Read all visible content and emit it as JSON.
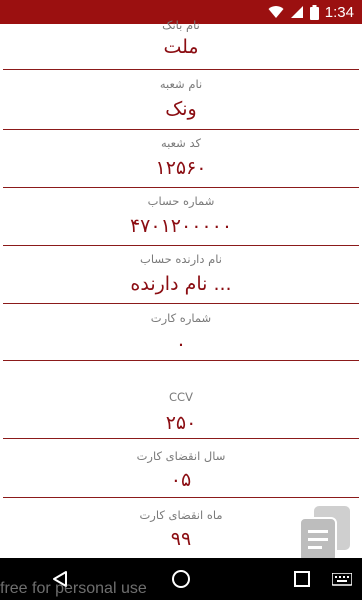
{
  "status_bar": {
    "time": "1:34"
  },
  "fields": [
    {
      "label": "نام بانک",
      "value": "ملت"
    },
    {
      "label": "نام شعبه",
      "value": "ونک"
    },
    {
      "label": "کد شعبه",
      "value": "۱۲۵۶۰"
    },
    {
      "label": "شماره حساب",
      "value": "۴۷۰۱۲۰۰۰۰۰"
    },
    {
      "label": "نام دارنده حساب",
      "value": "نام دارنده ..."
    },
    {
      "label": "شماره کارت",
      "value": "۰"
    },
    {
      "label": "CCV",
      "value": "۲۵۰"
    },
    {
      "label": "سال انقضای کارت",
      "value": "۰۵"
    },
    {
      "label": "ماه انقضای کارت",
      "value": "۹۹"
    }
  ],
  "watermark": "free for personal use",
  "colors": {
    "accent": "#9b1010",
    "value_text": "#8b0d12",
    "divider": "#8b1a1a"
  },
  "icons": [
    "wifi-icon",
    "signal-icon",
    "battery-icon",
    "back-icon",
    "home-icon",
    "recents-icon",
    "keyboard-icon"
  ]
}
